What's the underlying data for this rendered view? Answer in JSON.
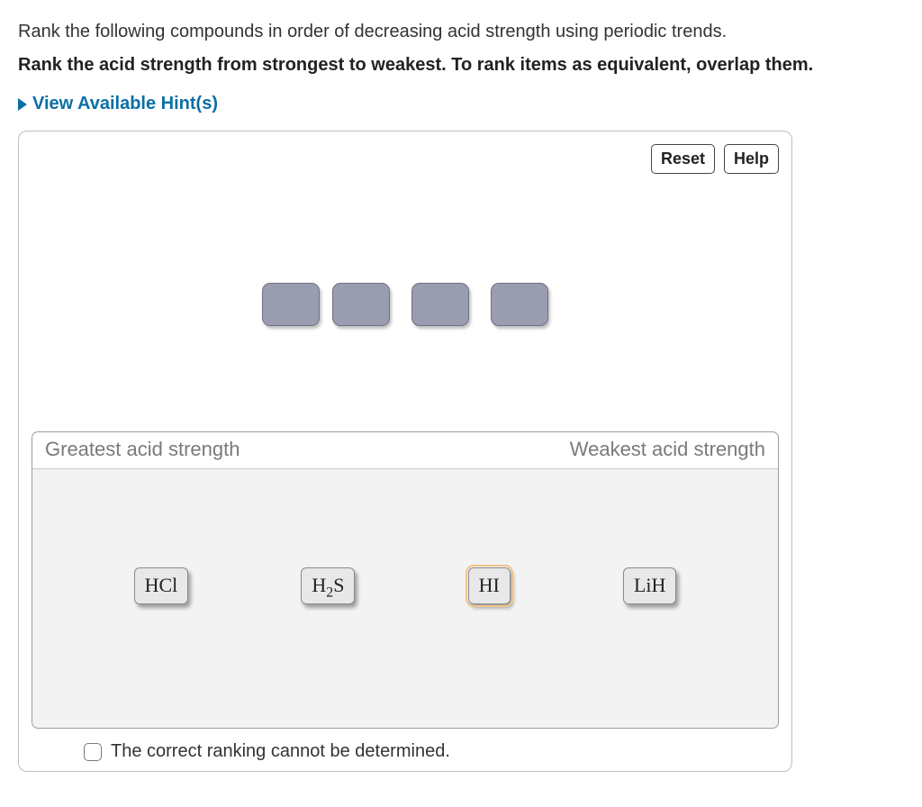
{
  "intro": "Rank the following compounds in order of decreasing acid strength using periodic trends.",
  "instruction": "Rank the acid strength from strongest to weakest. To rank items as equivalent, overlap them.",
  "hint_label": "View Available Hint(s)",
  "toolbar": {
    "reset": "Reset",
    "help": "Help"
  },
  "zone": {
    "left_label": "Greatest acid strength",
    "right_label": "Weakest acid strength"
  },
  "tokens": [
    {
      "formula_html": "HCl",
      "selected": false
    },
    {
      "formula_html": "H2S",
      "selected": false
    },
    {
      "formula_html": "HI",
      "selected": true
    },
    {
      "formula_html": "LiH",
      "selected": false
    }
  ],
  "checkbox_label": "The correct ranking cannot be determined."
}
